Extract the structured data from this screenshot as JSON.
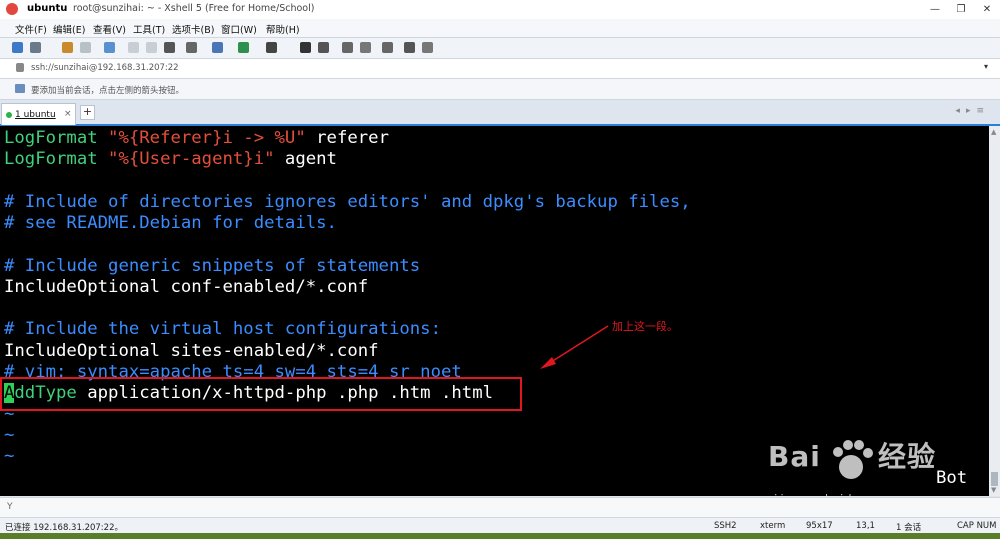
{
  "window": {
    "app_name": "ubuntu",
    "caption": "root@sunzihai: ~ - Xshell 5 (Free for Home/School)",
    "minimize": "—",
    "restore": "❐",
    "close": "✕"
  },
  "menu": [
    "文件(F)",
    "编辑(E)",
    "查看(V)",
    "工具(T)",
    "选项卡(B)",
    "窗口(W)",
    "帮助(H)"
  ],
  "address": {
    "value": "ssh://sunzihai@192.168.31.207:22",
    "dropdown": "▾"
  },
  "hint": {
    "text": "要添加当前会话，点击左侧的箭头按钮。"
  },
  "tabs": [
    {
      "label": "1 ubuntu",
      "close": "×"
    }
  ],
  "tab_add": "+",
  "tab_nav": "◂▸≡",
  "terminal": {
    "lines": [
      {
        "kw": "LogFormat",
        "str": "\"%{Referer}i -> %U\"",
        "tail": " referer"
      },
      {
        "kw": "LogFormat",
        "str": "\"%{User-agent}i\"",
        "tail": " agent"
      },
      {
        "comment": "# Include of directories ignores editors' and dpkg's backup files,"
      },
      {
        "comment": "# see README.Debian for details."
      },
      {
        "comment": "# Include generic snippets of statements"
      },
      {
        "text": "IncludeOptional conf-enabled/*.conf"
      },
      {
        "comment": "# Include the virtual host configurations:"
      },
      {
        "text": "IncludeOptional sites-enabled/*.conf"
      },
      {
        "comment": "# vim: syntax=apache ts=4 sw=4 sts=4 sr noet"
      },
      {
        "cursor": "A",
        "kw": "ddType",
        "tail": " application/x-httpd-php .php .htm .html"
      },
      {
        "tilde": "~"
      },
      {
        "tilde": "~"
      },
      {
        "tilde": "~"
      }
    ],
    "partial_right": "Bot"
  },
  "annotation": {
    "text": "加上这一段。",
    "color": "#e0181e"
  },
  "watermark": {
    "brand": "Bai",
    "brand2": "经验",
    "url": "jingyan.baidu.com"
  },
  "input_placeholder": "Y",
  "status": {
    "connection": "已连接 192.168.31.207:22。",
    "protocol": "SSH2",
    "term": "xterm",
    "size": "95x17",
    "cursor_pos": "13,1",
    "sessions": "1 会话",
    "caps": "CAP NUM"
  },
  "colors": {
    "accent": "#2a7fd8",
    "keyword": "#41d17a",
    "string": "#e3503a",
    "comment": "#3b8dff"
  }
}
